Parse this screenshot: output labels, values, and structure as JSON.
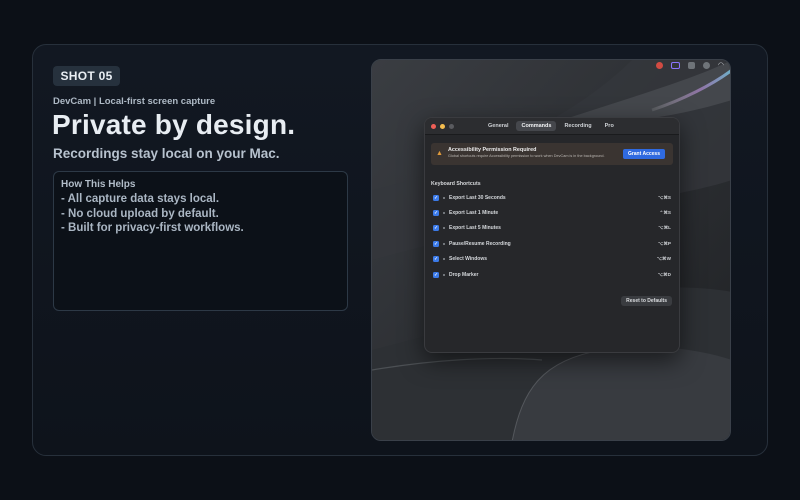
{
  "badge": "SHOT 05",
  "subtitle": "DevCam | Local-first screen capture",
  "headline": "Private by design.",
  "tagline": "Recordings stay local on your Mac.",
  "help": {
    "title": "How This Helps",
    "items": [
      "- All capture data stays local.",
      "- No cloud upload by default.",
      "- Built for privacy-first workflows."
    ]
  },
  "window": {
    "tabs": [
      "General",
      "Commands",
      "Recording",
      "Pro"
    ],
    "active_tab": "Commands",
    "warning": {
      "title": "Accessibility Permission Required",
      "text": "Global shortcuts require Accessibility permission to work when DevCam is in the background.",
      "button": "Grant Access"
    },
    "section_title": "Keyboard Shortcuts",
    "shortcuts": [
      {
        "label": "Export Last 30 Seconds",
        "keys": "⌥⌘S",
        "checked": true
      },
      {
        "label": "Export Last 1 Minute",
        "keys": "⌃⌘S",
        "checked": true
      },
      {
        "label": "Export Last 5 Minutes",
        "keys": "⌥⌘L",
        "checked": true
      },
      {
        "label": "Pause/Resume Recording",
        "keys": "⌥⌘P",
        "checked": true
      },
      {
        "label": "Select Windows",
        "keys": "⌥⌘W",
        "checked": true
      },
      {
        "label": "Drop Marker",
        "keys": "⌥⌘D",
        "checked": true
      }
    ],
    "reset_button": "Reset to Defaults"
  },
  "colors": {
    "accent": "#2f6ae0",
    "warning": "#e09a3b",
    "traffic_red": "#ee5f57",
    "traffic_yellow": "#f4bd4f",
    "traffic_inactive": "#5a5b5f"
  },
  "menubar_icons": [
    "record-indicator-icon",
    "screen-capture-icon",
    "control-center-icon",
    "user-icon",
    "wifi-icon"
  ]
}
